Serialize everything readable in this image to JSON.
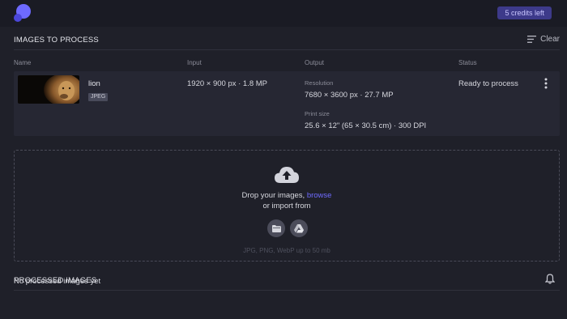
{
  "header": {
    "credits_label": "5 credits left"
  },
  "to_process": {
    "title": "IMAGES TO PROCESS",
    "clear_label": "Clear",
    "columns": {
      "name": "Name",
      "input": "Input",
      "output": "Output",
      "status": "Status"
    },
    "items": [
      {
        "filename": "lion",
        "format": "JPEG",
        "input": "1920 × 900 px · 1.8 MP",
        "resolution_label": "Resolution",
        "resolution_value": "7680 × 3600 px · 27.7 MP",
        "print_label": "Print size",
        "print_value": "25.6 × 12\" (65 × 30.5 cm) · 300 DPI",
        "status": "Ready to process"
      }
    ]
  },
  "dropzone": {
    "text_prefix": "Drop your images, ",
    "browse_label": "browse",
    "import_label": "or import from",
    "hint": "JPG, PNG, WebP up to 50 mb"
  },
  "processed": {
    "title": "PROCESSED IMAGES",
    "empty_text": "No processed images yet"
  },
  "colors": {
    "accent": "#6f6bff",
    "credits_bg": "#3d3a8a",
    "background": "#1f2029"
  }
}
